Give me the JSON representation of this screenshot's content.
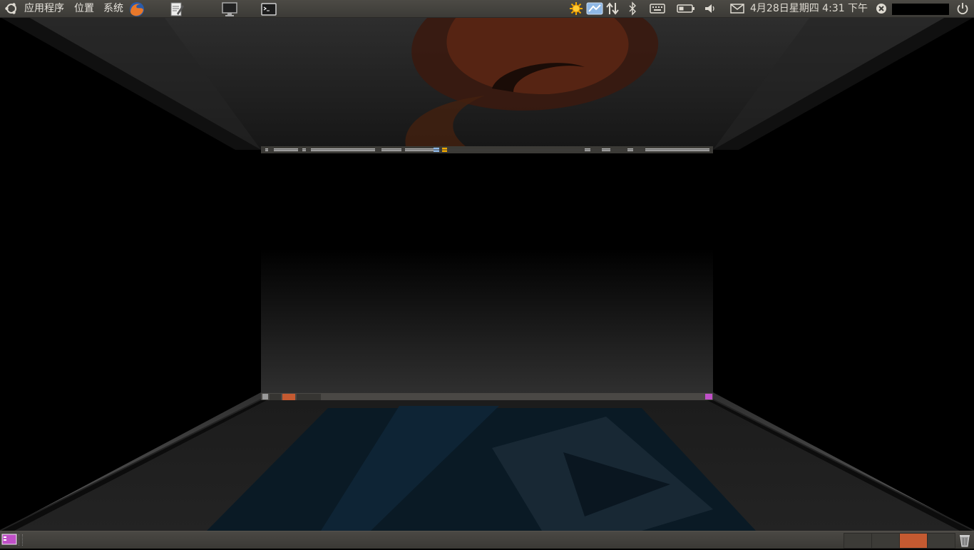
{
  "top_panel": {
    "menus": {
      "applications": "应用程序",
      "places": "位置",
      "system": "系统"
    },
    "launchers": [
      "firefox-icon",
      "text-editor-icon",
      "monitor-icon",
      "terminal-icon"
    ],
    "indicators": [
      "update-sun-icon",
      "network-transfer-icon",
      "updown-arrows-icon",
      "bluetooth-icon",
      "keyboard-icon",
      "battery-icon",
      "volume-icon",
      "mail-icon"
    ],
    "clock": "4月28日星期四 4:31 下午"
  },
  "bottom_panel": {
    "workspaces": [
      {
        "name": "workspace-1",
        "active": false
      },
      {
        "name": "workspace-2",
        "active": false
      },
      {
        "name": "workspace-3",
        "active": true
      },
      {
        "name": "workspace-4",
        "active": false
      }
    ]
  },
  "colors": {
    "panel": "#3c3b37",
    "accent": "#c45a31",
    "text": "#dfdbd2"
  }
}
